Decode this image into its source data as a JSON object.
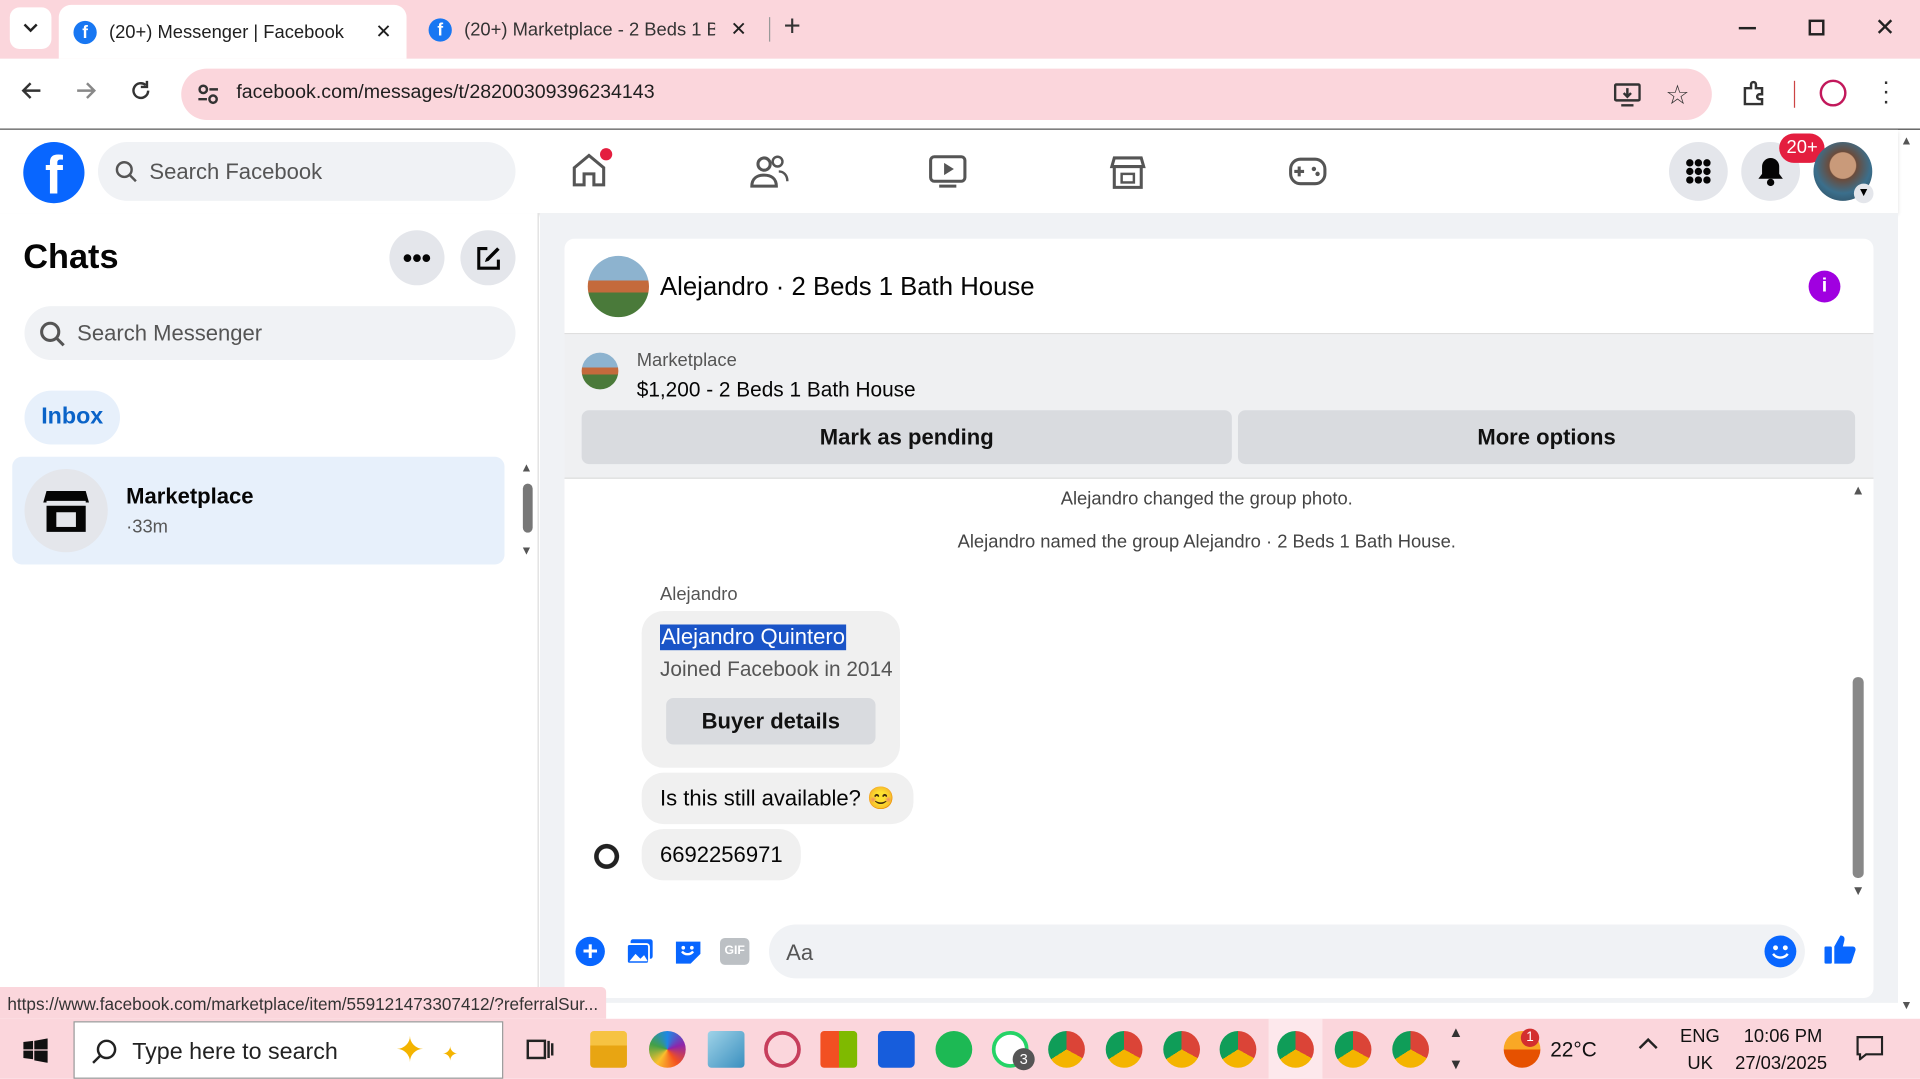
{
  "browser": {
    "tabs": [
      {
        "title": "(20+) Messenger | Facebook",
        "active": true
      },
      {
        "title": "(20+) Marketplace - 2 Beds 1 Ba",
        "active": false
      }
    ],
    "url": "facebook.com/messages/t/28200309396234143",
    "status_url": "https://www.facebook.com/marketplace/item/559121473307412/?referralSur..."
  },
  "header": {
    "search_placeholder": "Search Facebook",
    "notification_badge": "20+"
  },
  "sidebar": {
    "title": "Chats",
    "search_placeholder": "Search Messenger",
    "filter_label": "Inbox",
    "conversations": [
      {
        "name": "Marketplace",
        "meta": "·33m"
      }
    ]
  },
  "chat": {
    "title": "Alejandro · 2 Beds 1 Bath House",
    "listing": {
      "label": "Marketplace",
      "price_title": "$1,200 - 2 Beds 1 Bath House",
      "mark_pending": "Mark as pending",
      "more_options": "More options"
    },
    "system_messages": [
      "Alejandro changed the group photo.",
      "Alejandro named the group Alejandro · 2 Beds 1 Bath House."
    ],
    "sender": "Alejandro",
    "buyer_card": {
      "name": "Alejandro Quintero",
      "joined": "Joined Facebook in 2014",
      "button": "Buyer details"
    },
    "messages": [
      "Is this still available? 😊",
      "6692256971"
    ],
    "composer_placeholder": "Aa"
  },
  "taskbar": {
    "search_placeholder": "Type here to search",
    "whatsapp_badge": "3",
    "weather_badge": "1",
    "temperature": "22°C",
    "language": "ENG",
    "region": "UK",
    "time": "10:06 PM",
    "date": "27/03/2025"
  }
}
